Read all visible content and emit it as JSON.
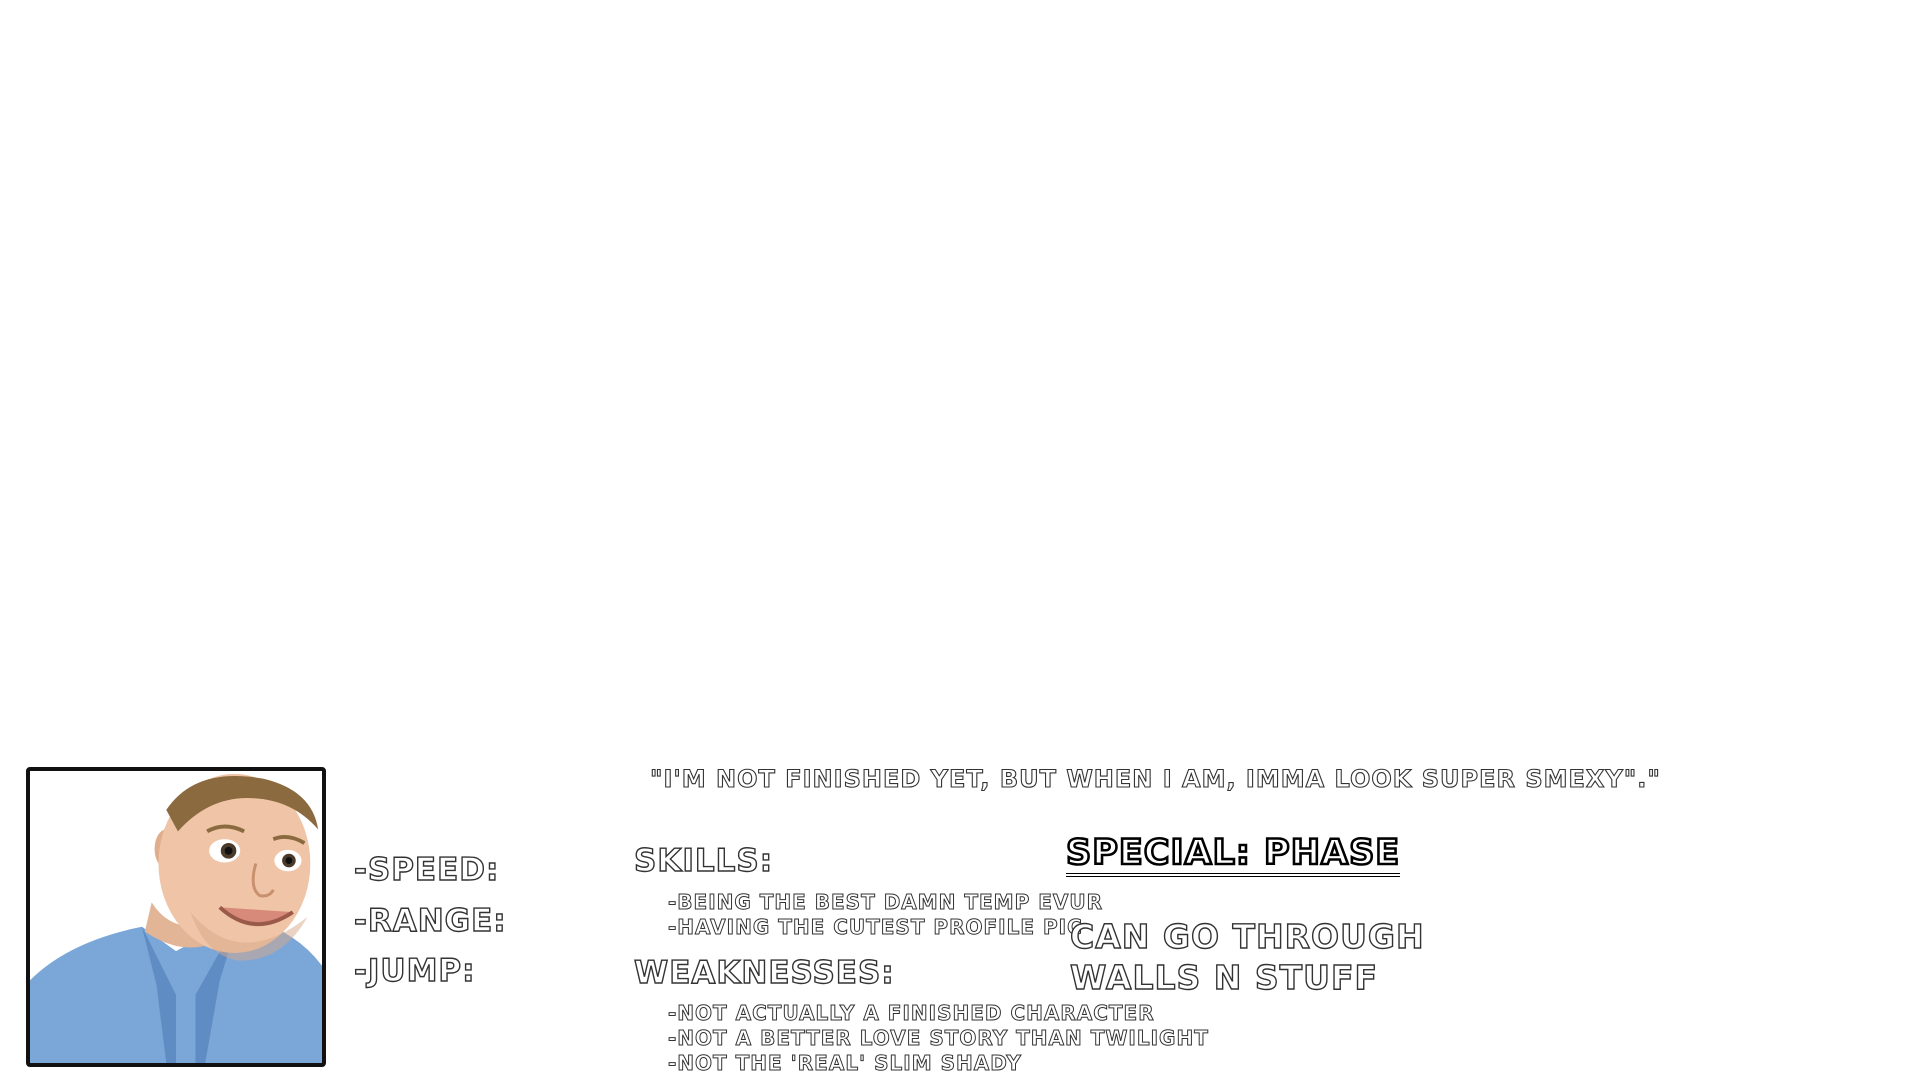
{
  "quote": "\"I'm not finished yet, but when I am, imma look super smexy\".\"",
  "stats": {
    "speed": "-Speed:",
    "range": "-Range:",
    "jump": "-Jump:"
  },
  "skills": {
    "heading": "Skills:",
    "items": [
      "-Being the best damn temp evur",
      "-Having the cutest profile pic"
    ]
  },
  "weaknesses": {
    "heading": "Weaknesses:",
    "items": [
      "-Not actually a finished character",
      "-Not a better love story than Twilight",
      "-Not the 'real' Slim Shady"
    ]
  },
  "special": {
    "title": "Special: Phase",
    "lines": [
      "Can go through",
      "walls n stuff"
    ]
  },
  "colors": {
    "outline": "#222222",
    "fill": "#ffffff",
    "portrait_border": "#111111",
    "shirt": "#7aa6d8"
  },
  "icons": {
    "portrait": "character-portrait"
  }
}
